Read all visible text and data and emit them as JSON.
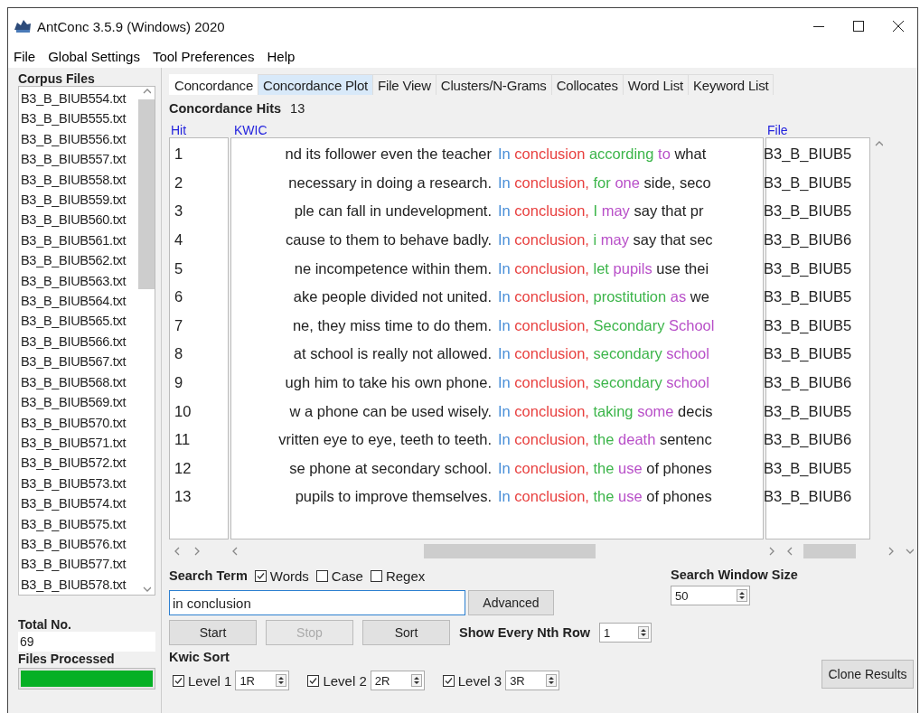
{
  "window": {
    "title": "AntConc 3.5.9 (Windows) 2020"
  },
  "menu": [
    "File",
    "Global Settings",
    "Tool Preferences",
    "Help"
  ],
  "sidebar": {
    "title": "Corpus Files",
    "files": [
      "B3_B_BIUB554.txt",
      "B3_B_BIUB555.txt",
      "B3_B_BIUB556.txt",
      "B3_B_BIUB557.txt",
      "B3_B_BIUB558.txt",
      "B3_B_BIUB559.txt",
      "B3_B_BIUB560.txt",
      "B3_B_BIUB561.txt",
      "B3_B_BIUB562.txt",
      "B3_B_BIUB563.txt",
      "B3_B_BIUB564.txt",
      "B3_B_BIUB565.txt",
      "B3_B_BIUB566.txt",
      "B3_B_BIUB567.txt",
      "B3_B_BIUB568.txt",
      "B3_B_BIUB569.txt",
      "B3_B_BIUB570.txt",
      "B3_B_BIUB571.txt",
      "B3_B_BIUB572.txt",
      "B3_B_BIUB573.txt",
      "B3_B_BIUB574.txt",
      "B3_B_BIUB575.txt",
      "B3_B_BIUB576.txt",
      "B3_B_BIUB577.txt",
      "B3_B_BIUB578.txt"
    ],
    "total_label": "Total No.",
    "total_value": "69",
    "processed_label": "Files Processed",
    "progress": {
      "level": 1
    }
  },
  "tabs": [
    {
      "label": "Concordance",
      "selected": true,
      "hovered": false
    },
    {
      "label": "Concordance Plot",
      "selected": false,
      "hovered": true
    },
    {
      "label": "File View",
      "selected": false,
      "hovered": false
    },
    {
      "label": "Clusters/N-Grams",
      "selected": false,
      "hovered": false
    },
    {
      "label": "Collocates",
      "selected": false,
      "hovered": false
    },
    {
      "label": "Word List",
      "selected": false,
      "hovered": false
    },
    {
      "label": "Keyword List",
      "selected": false,
      "hovered": false
    }
  ],
  "hits": {
    "label": "Concordance Hits",
    "value": "13"
  },
  "table": {
    "columns": [
      "Hit",
      "KWIC",
      "File"
    ],
    "rows": [
      {
        "hit": "1",
        "left": "nd its follower even the teacher",
        "right": [
          {
            "text": "In",
            "color": "#4a8fd8"
          },
          {
            "text": "conclusion",
            "color": "#e8403f"
          },
          {
            "text": "according",
            "color": "#3cb54a"
          },
          {
            "text": "to",
            "color": "#b84fc8"
          },
          {
            "text": "what"
          }
        ],
        "file": "B3_B_BIUB5"
      },
      {
        "hit": "2",
        "left": "necessary in doing a research.",
        "right": [
          {
            "text": "In",
            "color": "#4a8fd8"
          },
          {
            "text": "conclusion,",
            "color": "#e8403f"
          },
          {
            "text": "for",
            "color": "#3cb54a"
          },
          {
            "text": "one",
            "color": "#b84fc8"
          },
          {
            "text": "side, seco"
          }
        ],
        "file": "B3_B_BIUB5"
      },
      {
        "hit": "3",
        "left": "ple can fall in undevelopment.",
        "right": [
          {
            "text": "In",
            "color": "#4a8fd8"
          },
          {
            "text": "conclusion,",
            "color": "#e8403f"
          },
          {
            "text": "I",
            "color": "#3cb54a"
          },
          {
            "text": "may",
            "color": "#b84fc8"
          },
          {
            "text": "say that pr"
          }
        ],
        "file": "B3_B_BIUB5"
      },
      {
        "hit": "4",
        "left": "cause to them to behave badly.",
        "right": [
          {
            "text": "In",
            "color": "#4a8fd8"
          },
          {
            "text": "conclusion,",
            "color": "#e8403f"
          },
          {
            "text": "i",
            "color": "#3cb54a"
          },
          {
            "text": "may",
            "color": "#b84fc8"
          },
          {
            "text": "say that sec"
          }
        ],
        "file": "B3_B_BIUB6"
      },
      {
        "hit": "5",
        "left": "ne incompetence within them.",
        "right": [
          {
            "text": "In",
            "color": "#4a8fd8"
          },
          {
            "text": "conclusion,",
            "color": "#e8403f"
          },
          {
            "text": "let",
            "color": "#3cb54a"
          },
          {
            "text": "pupils",
            "color": "#b84fc8"
          },
          {
            "text": "use thei"
          }
        ],
        "file": "B3_B_BIUB5"
      },
      {
        "hit": "6",
        "left": "ake people divided not united.",
        "right": [
          {
            "text": "In",
            "color": "#4a8fd8"
          },
          {
            "text": "conclusion,",
            "color": "#e8403f"
          },
          {
            "text": "prostitution",
            "color": "#3cb54a"
          },
          {
            "text": "as",
            "color": "#b84fc8"
          },
          {
            "text": "we"
          }
        ],
        "file": "B3_B_BIUB5"
      },
      {
        "hit": "7",
        "left": "ne, they miss time to do them.",
        "right": [
          {
            "text": "In",
            "color": "#4a8fd8"
          },
          {
            "text": "conclusion,",
            "color": "#e8403f"
          },
          {
            "text": "Secondary",
            "color": "#3cb54a"
          },
          {
            "text": "School",
            "color": "#b84fc8"
          }
        ],
        "file": "B3_B_BIUB5"
      },
      {
        "hit": "8",
        "left": "at school is really not allowed.",
        "right": [
          {
            "text": "In",
            "color": "#4a8fd8"
          },
          {
            "text": "conclusion,",
            "color": "#e8403f"
          },
          {
            "text": "secondary",
            "color": "#3cb54a"
          },
          {
            "text": "school",
            "color": "#b84fc8"
          }
        ],
        "file": "B3_B_BIUB5"
      },
      {
        "hit": "9",
        "left": "ugh him to take his own phone.",
        "right": [
          {
            "text": "In",
            "color": "#4a8fd8"
          },
          {
            "text": "conclusion,",
            "color": "#e8403f"
          },
          {
            "text": "secondary",
            "color": "#3cb54a"
          },
          {
            "text": "school",
            "color": "#b84fc8"
          }
        ],
        "file": "B3_B_BIUB6"
      },
      {
        "hit": "10",
        "left": "w a phone can be used wisely.",
        "right": [
          {
            "text": "In",
            "color": "#4a8fd8"
          },
          {
            "text": "conclusion,",
            "color": "#e8403f"
          },
          {
            "text": "taking",
            "color": "#3cb54a"
          },
          {
            "text": "some",
            "color": "#b84fc8"
          },
          {
            "text": "decis"
          }
        ],
        "file": "B3_B_BIUB5"
      },
      {
        "hit": "11",
        "left": "vritten eye to eye, teeth to teeth.",
        "right": [
          {
            "text": "In",
            "color": "#4a8fd8"
          },
          {
            "text": "conclusion,",
            "color": "#e8403f"
          },
          {
            "text": "the",
            "color": "#3cb54a"
          },
          {
            "text": "death",
            "color": "#b84fc8"
          },
          {
            "text": "sentenc"
          }
        ],
        "file": "B3_B_BIUB6"
      },
      {
        "hit": "12",
        "left": "se phone at secondary school.",
        "right": [
          {
            "text": "In",
            "color": "#4a8fd8"
          },
          {
            "text": "conclusion,",
            "color": "#e8403f"
          },
          {
            "text": "the",
            "color": "#3cb54a"
          },
          {
            "text": "use",
            "color": "#b84fc8"
          },
          {
            "text": "of phones"
          }
        ],
        "file": "B3_B_BIUB5"
      },
      {
        "hit": "13",
        "left": "pupils to improve themselves.",
        "right": [
          {
            "text": "In",
            "color": "#4a8fd8"
          },
          {
            "text": "conclusion,",
            "color": "#e8403f"
          },
          {
            "text": "the",
            "color": "#3cb54a"
          },
          {
            "text": "use",
            "color": "#b84fc8"
          },
          {
            "text": "of phones"
          }
        ],
        "file": "B3_B_BIUB6"
      }
    ]
  },
  "search": {
    "label": "Search Term",
    "options": [
      {
        "label": "Words",
        "checked": true
      },
      {
        "label": "Case",
        "checked": false
      },
      {
        "label": "Regex",
        "checked": false
      }
    ],
    "value": "in conclusion",
    "advanced": "Advanced",
    "window_size_label": "Search Window Size",
    "window_size": "50"
  },
  "buttons": [
    {
      "label": "Start",
      "disabled": false
    },
    {
      "label": "Stop",
      "disabled": true
    },
    {
      "label": "Sort",
      "disabled": false
    }
  ],
  "nth_row": {
    "label": "Show Every Nth Row",
    "value": "1"
  },
  "kwic_sort": {
    "label": "Kwic Sort",
    "levels": [
      {
        "label": "Level 1",
        "checked": true,
        "value": "1R"
      },
      {
        "label": "Level 2",
        "checked": true,
        "value": "2R"
      },
      {
        "label": "Level 3",
        "checked": true,
        "value": "3R"
      }
    ]
  },
  "clone": "Clone Results"
}
